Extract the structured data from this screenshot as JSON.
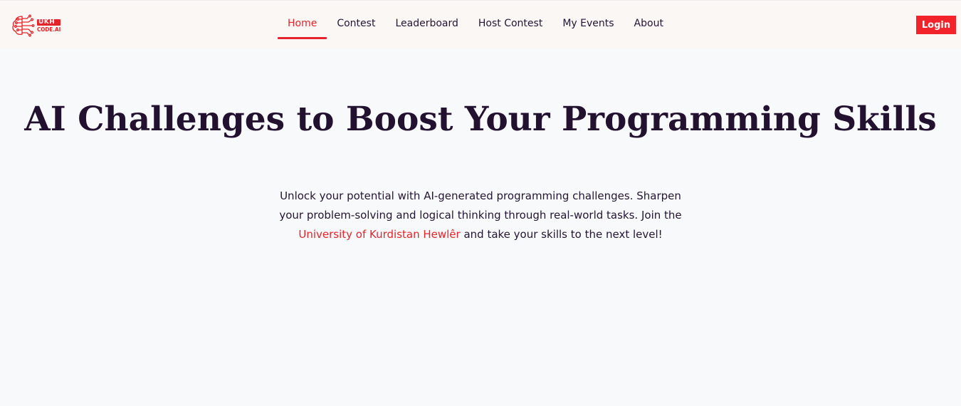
{
  "header": {
    "logo": {
      "badge_text": "UKH",
      "sub_text": "CODE.AI",
      "icon": "brain-circuit-icon"
    },
    "nav": [
      {
        "label": "Home",
        "active": true
      },
      {
        "label": "Contest",
        "active": false
      },
      {
        "label": "Leaderboard",
        "active": false
      },
      {
        "label": "Host Contest",
        "active": false
      },
      {
        "label": "My Events",
        "active": false
      },
      {
        "label": "About",
        "active": false
      }
    ],
    "login_label": "Login"
  },
  "hero": {
    "title": "AI Challenges to Boost Your Programming Skills",
    "subtitle_before": "Unlock your potential with AI-generated programming challenges. Sharpen your problem-solving and logical thinking through real-world tasks. Join the ",
    "subtitle_highlight": "University of Kurdistan Hewlêr",
    "subtitle_after": " and take your skills to the next level!"
  },
  "colors": {
    "accent": "#e5232b",
    "text_dark": "#22112f",
    "header_bg": "#fbf7f5",
    "page_bg": "#f8f9fb"
  }
}
